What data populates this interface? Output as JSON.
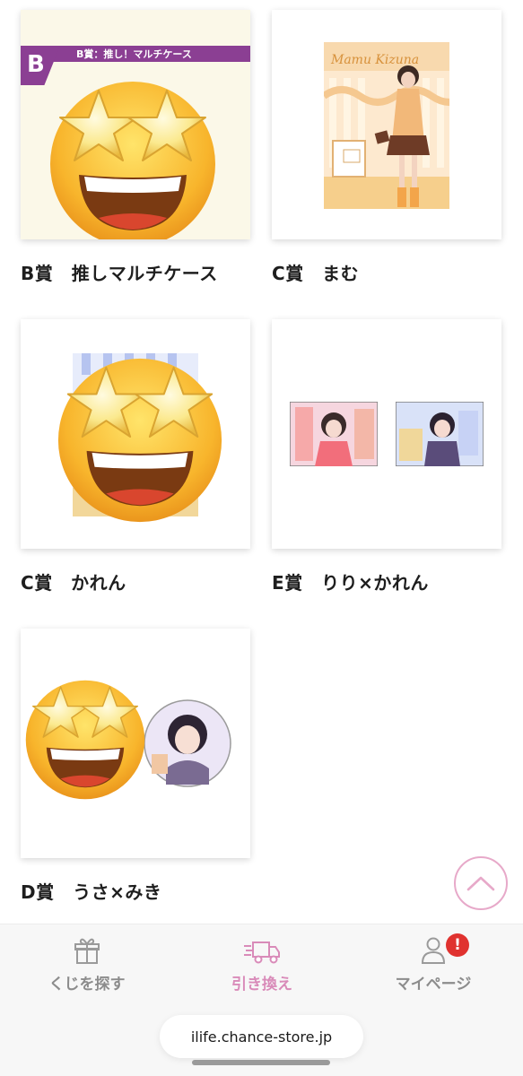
{
  "items": [
    {
      "title": "B賞　推しマルチケース",
      "badge_letter": "B",
      "banner_text": "B賞：推し！マルチケース"
    },
    {
      "title": "C賞　まむ",
      "signature_text": "Mamu Kizuna"
    },
    {
      "title": "C賞　かれん"
    },
    {
      "title": "E賞　りり×かれん"
    },
    {
      "title": "D賞　うさ×みき"
    }
  ],
  "scroll_top": {
    "icon": "chevron-up-icon"
  },
  "bottom_nav": {
    "items": [
      {
        "label": "くじを探す",
        "icon": "gift-icon",
        "active": false
      },
      {
        "label": "引き換え",
        "icon": "delivery-truck-icon",
        "active": true
      },
      {
        "label": "マイページ",
        "icon": "user-icon",
        "active": false,
        "alert": "!"
      }
    ]
  },
  "browser": {
    "url": "ilife.chance-store.jp"
  },
  "colors": {
    "accent_pink": "#d98bb9",
    "banner_purple": "#8b3f93",
    "alert_red": "#e0322f"
  }
}
